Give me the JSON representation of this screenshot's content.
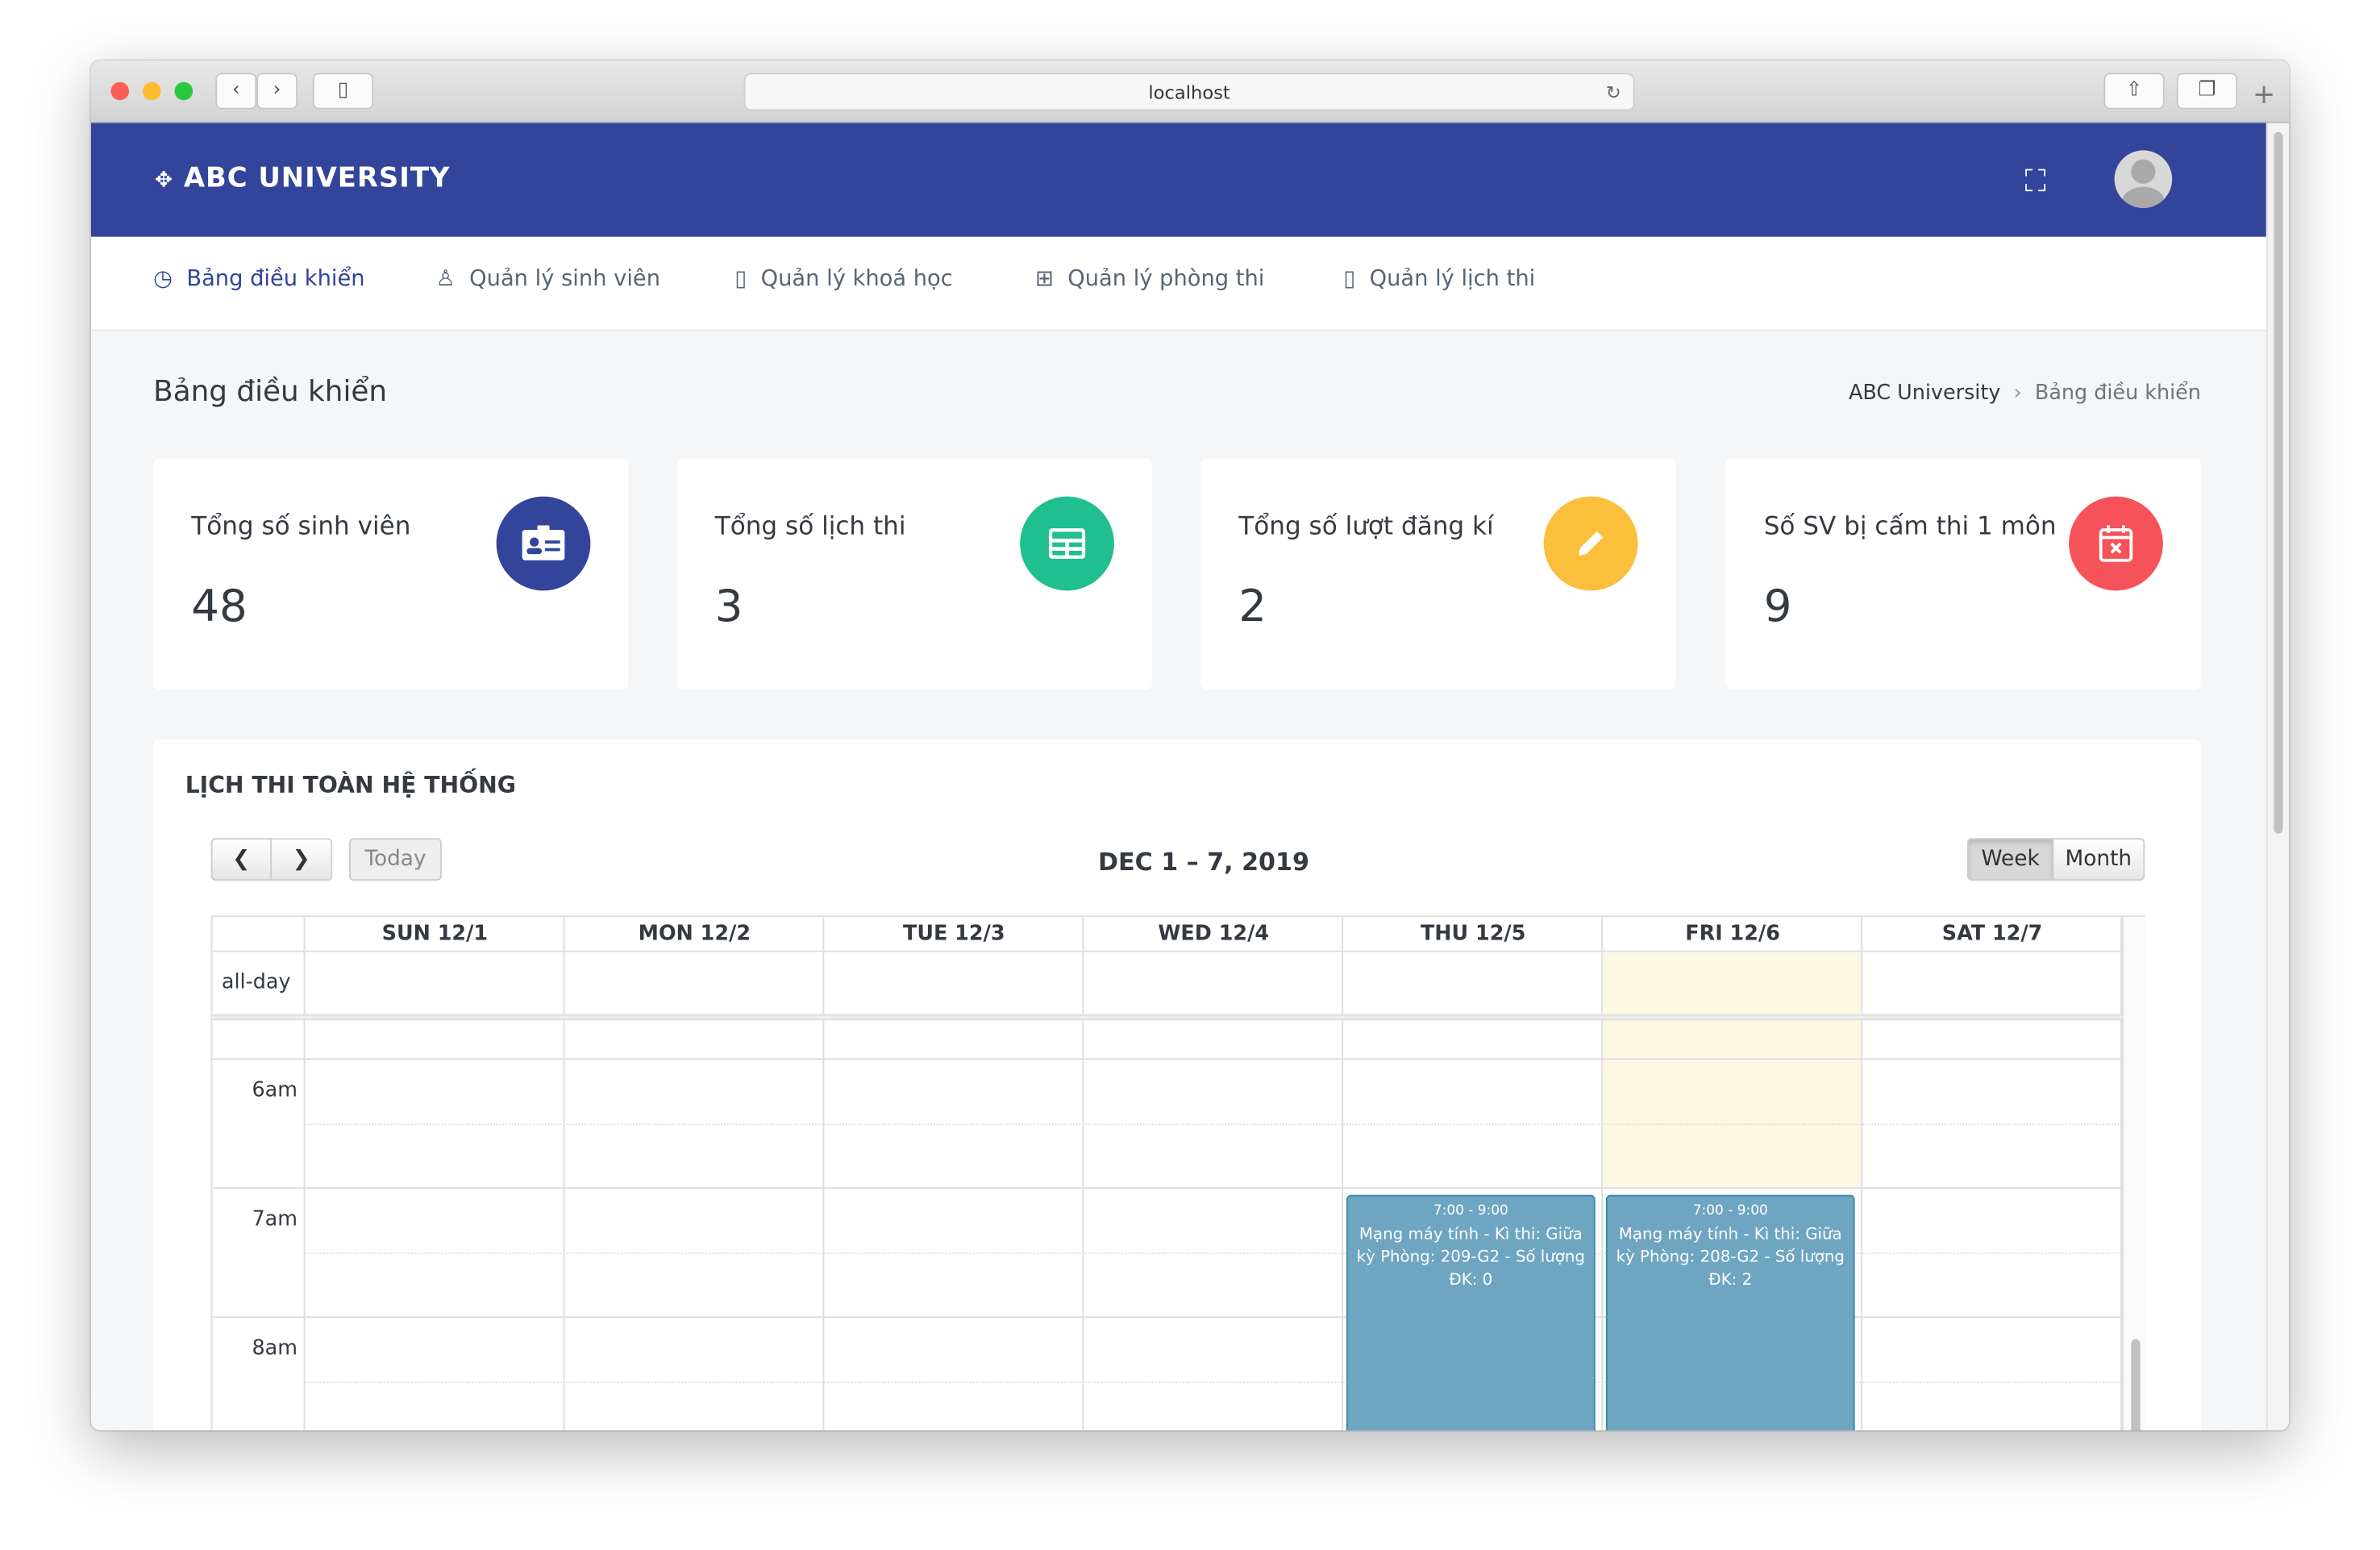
{
  "browser": {
    "url": "localhost"
  },
  "header": {
    "brand": "ABC UNIVERSITY",
    "color": "#32459a"
  },
  "nav": [
    {
      "label": "Bảng điều khiển",
      "icon": "dashboard-icon",
      "active": true
    },
    {
      "label": "Quản lý sinh viên",
      "icon": "user-icon"
    },
    {
      "label": "Quản lý khoá học",
      "icon": "book-icon"
    },
    {
      "label": "Quản lý phòng thi",
      "icon": "folder-plus-icon"
    },
    {
      "label": "Quản lý lịch thi",
      "icon": "book-icon"
    }
  ],
  "page": {
    "title": "Bảng điều khiển",
    "breadcrumb": [
      "ABC University",
      "Bảng điều khiển"
    ]
  },
  "cards": [
    {
      "label": "Tổng số sinh viên",
      "value": "48",
      "icon": "id-card-icon",
      "color": "#32459a"
    },
    {
      "label": "Tổng số lịch thi",
      "value": "3",
      "icon": "table-icon",
      "color": "#1fbf8f"
    },
    {
      "label": "Tổng số lượt đăng kí",
      "value": "2",
      "icon": "pencil-icon",
      "color": "#fbbf3b"
    },
    {
      "label": "Số SV bị cấm thi 1 môn",
      "value": "9",
      "icon": "calendar-x-icon",
      "color": "#f5525a"
    }
  ],
  "calendar": {
    "title": "LỊCH THI TOÀN HỆ THỐNG",
    "today": "Today",
    "range": "DEC 1 – 7, 2019",
    "week": "Week",
    "month": "Month",
    "view": "Week",
    "allday": "all-day",
    "days": [
      "SUN 12/1",
      "MON 12/2",
      "TUE 12/3",
      "WED 12/4",
      "THU 12/5",
      "FRI 12/6",
      "SAT 12/7"
    ],
    "highlight_day": "FRI 12/6",
    "hours": [
      "6am",
      "7am",
      "8am"
    ],
    "events": [
      {
        "time": "7:00 - 9:00",
        "text": "Mạng máy tính - Kì thi: Giữa kỳ Phòng: 209-G2 - Số lượng ĐK: 0",
        "day": "THU 12/5"
      },
      {
        "time": "7:00 - 9:00",
        "text": "Mạng máy tính - Kì thi: Giữa kỳ Phòng: 208-G2 - Số lượng ĐK: 2",
        "day": "FRI 12/6"
      }
    ]
  }
}
